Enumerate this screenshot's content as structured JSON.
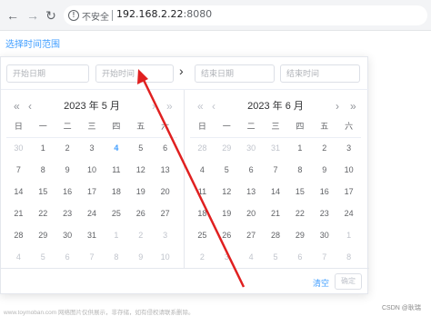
{
  "browser": {
    "back_icon": "back-arrow-icon",
    "forward_icon": "forward-arrow-icon",
    "reload_icon": "reload-icon",
    "security_label": "不安全",
    "url_host": "192.168.2.22",
    "url_port": ":8080"
  },
  "page": {
    "label": "选择时间范围"
  },
  "picker": {
    "start_date_placeholder": "开始日期",
    "start_time_placeholder": "开始时间",
    "separator": "›",
    "end_date_placeholder": "结束日期",
    "end_time_placeholder": "结束时间",
    "left_panel": {
      "title": "2023 年 5 月",
      "prev_year": "«",
      "prev_month": "‹",
      "next_month": "›",
      "next_year": "»",
      "weekdays": [
        "日",
        "一",
        "二",
        "三",
        "四",
        "五",
        "六"
      ],
      "weeks": [
        [
          "30",
          "1",
          "2",
          "3",
          "4",
          "5",
          "6"
        ],
        [
          "7",
          "8",
          "9",
          "10",
          "11",
          "12",
          "13"
        ],
        [
          "14",
          "15",
          "16",
          "17",
          "18",
          "19",
          "20"
        ],
        [
          "21",
          "22",
          "23",
          "24",
          "25",
          "26",
          "27"
        ],
        [
          "28",
          "29",
          "30",
          "31",
          "1",
          "2",
          "3"
        ],
        [
          "4",
          "5",
          "6",
          "7",
          "8",
          "9",
          "10"
        ]
      ]
    },
    "right_panel": {
      "title": "2023 年 6 月",
      "prev_year": "«",
      "prev_month": "‹",
      "next_month": "›",
      "next_year": "»",
      "weekdays": [
        "日",
        "一",
        "二",
        "三",
        "四",
        "五",
        "六"
      ],
      "weeks": [
        [
          "28",
          "29",
          "30",
          "31",
          "1",
          "2",
          "3"
        ],
        [
          "4",
          "5",
          "6",
          "7",
          "8",
          "9",
          "10"
        ],
        [
          "11",
          "12",
          "13",
          "14",
          "15",
          "16",
          "17"
        ],
        [
          "18",
          "19",
          "20",
          "21",
          "22",
          "23",
          "24"
        ],
        [
          "25",
          "26",
          "27",
          "28",
          "29",
          "30",
          "1"
        ],
        [
          "2",
          "3",
          "4",
          "5",
          "6",
          "7",
          "8"
        ]
      ]
    },
    "clear_label": "清空",
    "confirm_label": "确定"
  },
  "watermark": {
    "left": "www.toymoban.com 网络图片仅供展示，非存储，如有侵权请联系删除。",
    "right": "CSDN @耿瑞"
  },
  "colors": {
    "accent": "#409eff",
    "annotation_arrow": "#e02020",
    "muted_text": "#c0c4cc"
  }
}
